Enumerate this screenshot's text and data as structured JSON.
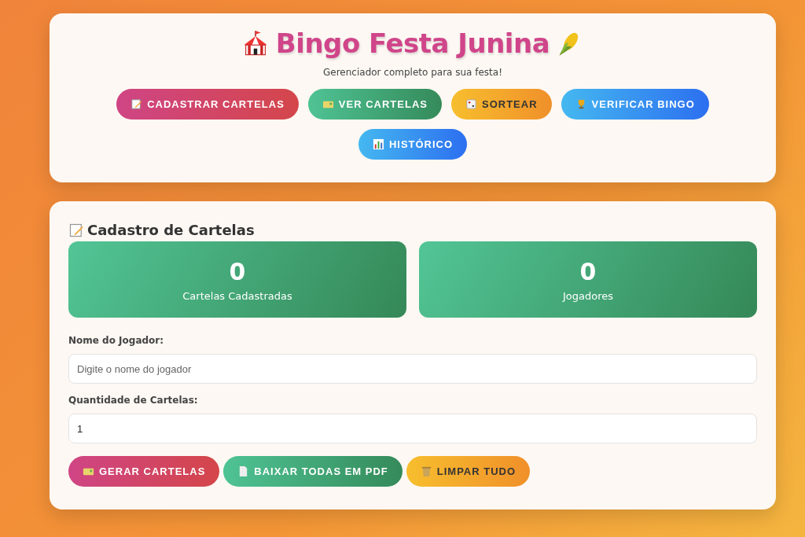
{
  "header": {
    "title": "Bingo Festa Junina",
    "subtitle": "Gerenciador completo para sua festa!"
  },
  "nav": [
    {
      "label": "CADASTRAR CARTELAS",
      "kind": "pink"
    },
    {
      "label": "VER CARTELAS",
      "kind": "green"
    },
    {
      "label": "SORTEAR",
      "kind": "yellow"
    },
    {
      "label": "VERIFICAR BINGO",
      "kind": "blue"
    },
    {
      "label": "HISTÓRICO",
      "kind": "blue"
    }
  ],
  "section": {
    "title": "Cadastro de Cartelas",
    "stats": [
      {
        "value": "0",
        "label": "Cartelas Cadastradas"
      },
      {
        "value": "0",
        "label": "Jogadores"
      }
    ],
    "fields": [
      {
        "label": "Nome do Jogador:",
        "placeholder": "Digite o nome do jogador"
      },
      {
        "label": "Quantidade de Cartelas:",
        "value": "1"
      }
    ],
    "actions": [
      {
        "label": "GERAR CARTELAS",
        "kind": "pink"
      },
      {
        "label": "BAIXAR TODAS EM PDF",
        "kind": "green"
      },
      {
        "label": "LIMPAR TUDO",
        "kind": "yellow"
      }
    ]
  }
}
